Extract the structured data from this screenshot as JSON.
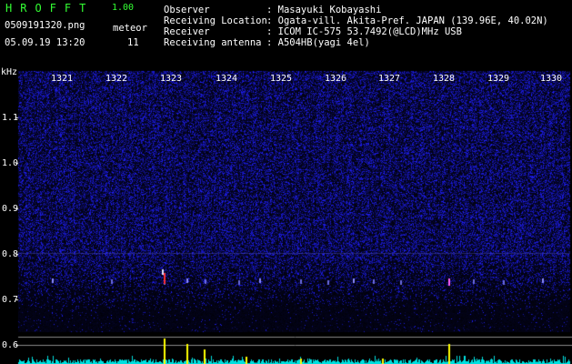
{
  "header": {
    "app_title": "HROFFT",
    "version": "1.00",
    "filename": "0509191320.png",
    "datetime": "05.09.19 13:20",
    "meteor_label": "meteor",
    "meteor_count": "11"
  },
  "info": [
    {
      "key": "Observer",
      "value": ": Masayuki Kobayashi"
    },
    {
      "key": "Receiving Location",
      "value": ": Ogata-vill. Akita-Pref. JAPAN (139.96E, 40.02N)"
    },
    {
      "key": "Receiver",
      "value": ": ICOM IC-575 53.7492(@LCD)MHz USB"
    },
    {
      "key": "Receiving antenna",
      "value": ": A504HB(yagi 4el)"
    }
  ],
  "axis": {
    "y_unit": "kHz",
    "y_ticks": [
      "1.1",
      "1.0",
      "0.9",
      "0.8",
      "0.7",
      "0.6"
    ],
    "x_ticks": [
      "1321",
      "1322",
      "1323",
      "1324",
      "1325",
      "1326",
      "1327",
      "1328",
      "1329",
      "1330"
    ]
  },
  "colors": {
    "title": "#33ff33",
    "background": "#000000",
    "noise": "#2020c0",
    "bar": "#ffff00",
    "baseline": "#00ffff"
  }
}
